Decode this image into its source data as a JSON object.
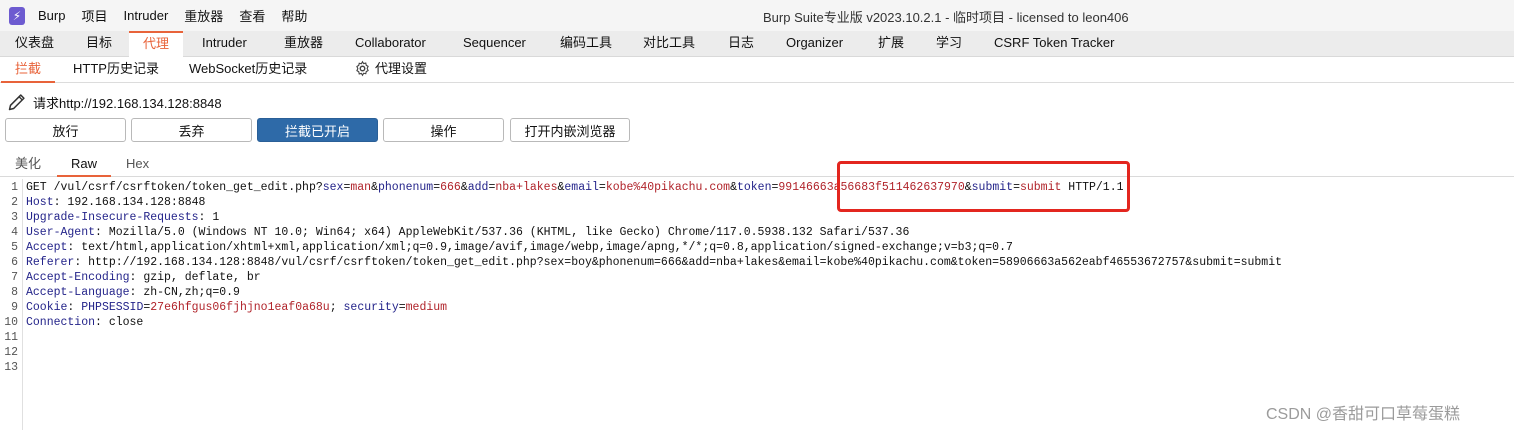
{
  "titlebar": {
    "menu": [
      "Burp",
      "项目",
      "Intruder",
      "重放器",
      "查看",
      "帮助"
    ],
    "window_title": "Burp Suite专业版  v2023.10.2.1 - 临时项目 - licensed to leon406"
  },
  "main_tabs": [
    "仪表盘",
    "目标",
    "代理",
    "Intruder",
    "重放器",
    "Collaborator",
    "Sequencer",
    "编码工具",
    "对比工具",
    "日志",
    "Organizer",
    "扩展",
    "学习",
    "CSRF Token Tracker"
  ],
  "main_tab_active": "代理",
  "sub_tabs": [
    "拦截",
    "HTTP历史记录",
    "WebSocket历史记录",
    "代理设置"
  ],
  "sub_tab_active": "拦截",
  "request_label": "请求http://192.168.134.128:8848",
  "buttons": {
    "forward": "放行",
    "drop": "丢弃",
    "intercept": "拦截已开启",
    "action": "操作",
    "browser": "打开内嵌浏览器"
  },
  "editor_tabs": [
    "美化",
    "Raw",
    "Hex"
  ],
  "editor_tab_active": "Raw",
  "line_numbers": [
    "1",
    "2",
    "3",
    "4",
    "5",
    "6",
    "7",
    "8",
    "9",
    "10",
    "11",
    "12",
    "13"
  ],
  "lines": {
    "l1": {
      "method_path": "GET /vul/csrf/csrftoken/token_get_edit.php?",
      "p1k": "sex",
      "p1v": "man",
      "p2k": "phonenum",
      "p2v": "666",
      "p3k": "add",
      "p3v": "nba+lakes",
      "p4k": "email",
      "p4v": "kobe%40pikachu.com",
      "p5k": "token",
      "p5v": "99146663a56683f511462637970",
      "p6k": "submit",
      "p6v": "submit",
      "proto": " HTTP/1.1"
    },
    "l2": {
      "k": "Host",
      "v": " 192.168.134.128:8848"
    },
    "l3": {
      "k": "Upgrade-Insecure-Requests",
      "v": " 1"
    },
    "l4": {
      "k": "User-Agent",
      "v": " Mozilla/5.0 (Windows NT 10.0; Win64; x64) AppleWebKit/537.36 (KHTML, like Gecko) Chrome/117.0.5938.132 Safari/537.36"
    },
    "l5": {
      "k": "Accept",
      "v": " text/html,application/xhtml+xml,application/xml;q=0.9,image/avif,image/webp,image/apng,*/*;q=0.8,application/signed-exchange;v=b3;q=0.7"
    },
    "l6": {
      "k": "Referer",
      "v": " http://192.168.134.128:8848/vul/csrf/csrftoken/token_get_edit.php?sex=boy&phonenum=666&add=nba+lakes&email=kobe%40pikachu.com&token=58906663a562eabf46553672757&submit=submit"
    },
    "l7": {
      "k": "Accept-Encoding",
      "v": " gzip, deflate, br"
    },
    "l8": {
      "k": "Accept-Language",
      "v": " zh-CN,zh;q=0.9"
    },
    "l9": {
      "k": "Cookie",
      "c1k": "PHPSESSID",
      "c1v": "27e6hfgus06fjhjno1eaf0a68u",
      "c2k": "security",
      "c2v": "medium"
    },
    "l10": {
      "k": "Connection",
      "v": " close"
    }
  },
  "watermark": "CSDN @香甜可口草莓蛋糕",
  "colors": {
    "accent": "#e8633a",
    "intercept_button": "#2e6aa8",
    "highlight_box": "#e3261f",
    "param_name": "#24248a",
    "param_value": "#b0232a"
  }
}
